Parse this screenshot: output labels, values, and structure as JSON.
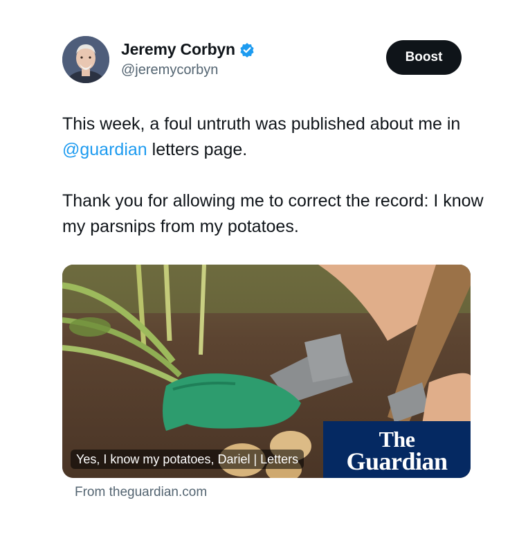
{
  "author": {
    "display_name": "Jeremy Corbyn",
    "handle": "@jeremycorbyn",
    "verified": true
  },
  "actions": {
    "boost_label": "Boost"
  },
  "tweet": {
    "line1_before": "This week, a foul untruth was published about me in ",
    "mention": "@guardian",
    "line1_after": " letters page.",
    "line2": "Thank you for allowing me to correct the record: I know my parsnips from my potatoes."
  },
  "card": {
    "headline": "Yes, I know my potatoes, Dariel | Letters",
    "brand_line1": "The",
    "brand_line2": "Guardian",
    "source": "From theguardian.com"
  },
  "colors": {
    "mention": "#1d9bf0",
    "verified_badge": "#1d9bf0",
    "boost_bg": "#0f1419",
    "guardian_blue": "#052962"
  }
}
